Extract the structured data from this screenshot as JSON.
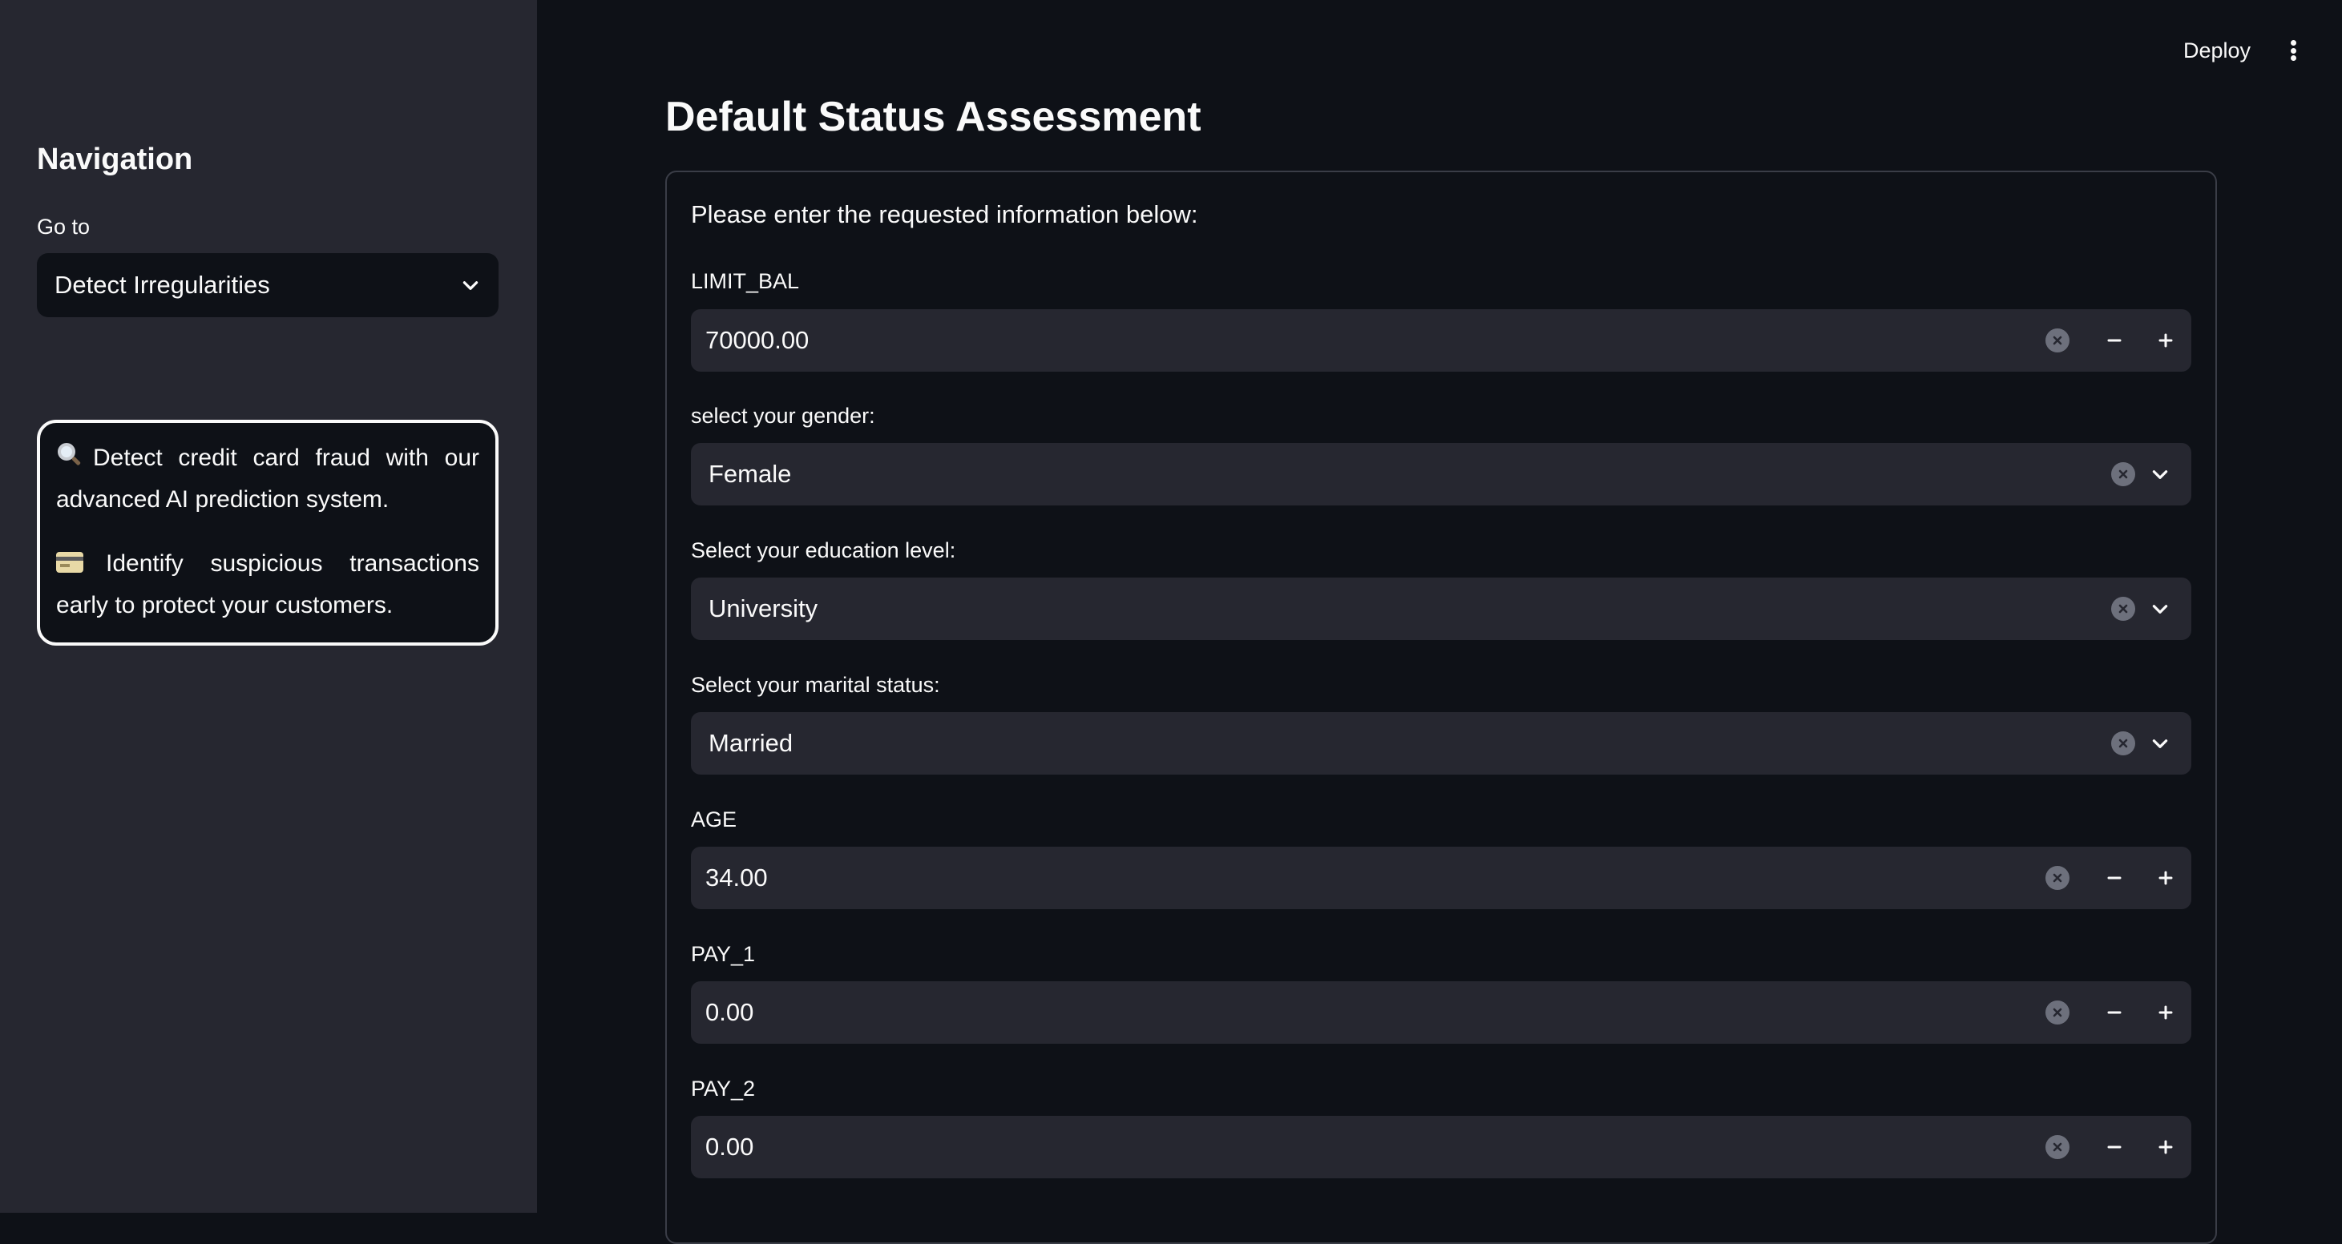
{
  "sidebar": {
    "title": "Navigation",
    "goto_label": "Go to",
    "selected_page": "Detect Irregularities",
    "info": [
      {
        "icon": "magnifier-icon",
        "text": "Detect credit card fraud with our advanced AI prediction system."
      },
      {
        "icon": "credit-card-icon",
        "text": "Identify suspicious transactions early to protect your customers."
      }
    ]
  },
  "topbar": {
    "deploy_label": "Deploy"
  },
  "main": {
    "title": "Default Status Assessment",
    "intro": "Please enter the requested information below:",
    "fields": [
      {
        "label": "LIMIT_BAL",
        "type": "number",
        "value": "70000.00"
      },
      {
        "label": "select your gender:",
        "type": "select",
        "value": "Female"
      },
      {
        "label": "Select your education level:",
        "type": "select",
        "value": "University"
      },
      {
        "label": "Select your marital status:",
        "type": "select",
        "value": "Married"
      },
      {
        "label": "AGE",
        "type": "number",
        "value": "34.00"
      },
      {
        "label": "PAY_1",
        "type": "number",
        "value": "0.00"
      },
      {
        "label": "PAY_2",
        "type": "number",
        "value": "0.00"
      }
    ]
  },
  "colors": {
    "background": "#0e1117",
    "sidebar": "#262730",
    "input": "#262730",
    "text": "#fafafa"
  }
}
